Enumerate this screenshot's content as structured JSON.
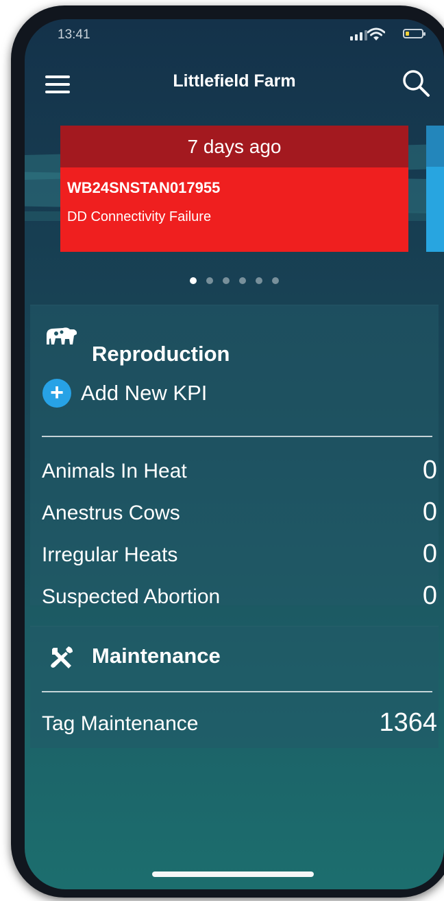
{
  "status_bar": {
    "time": "13:41"
  },
  "header": {
    "title": "Littlefield Farm",
    "menu_icon": "hamburger-menu-icon",
    "search_icon": "search-icon"
  },
  "alert": {
    "time_ago": "7 days ago",
    "tag_id": "WB24SNSTAN017955",
    "message": "DD Connectivity Failure",
    "color": "#ef1f1f",
    "header_color": "#a3191f"
  },
  "next_alert_card": {
    "color": "#28a5e0"
  },
  "carousel": {
    "page_count": 6,
    "active_index": 0
  },
  "reproduction": {
    "icon": "cow-icon",
    "title": "Reproduction",
    "add_kpi_label": "Add New KPI",
    "kpis": [
      {
        "label": "Animals In Heat",
        "value": "0"
      },
      {
        "label": "Anestrus Cows",
        "value": "0"
      },
      {
        "label": "Irregular Heats",
        "value": "0"
      },
      {
        "label": "Suspected Abortion",
        "value": "0"
      }
    ]
  },
  "maintenance": {
    "icon": "tools-icon",
    "title": "Maintenance",
    "kpis": [
      {
        "label": "Tag Maintenance",
        "value": "1364"
      }
    ]
  }
}
